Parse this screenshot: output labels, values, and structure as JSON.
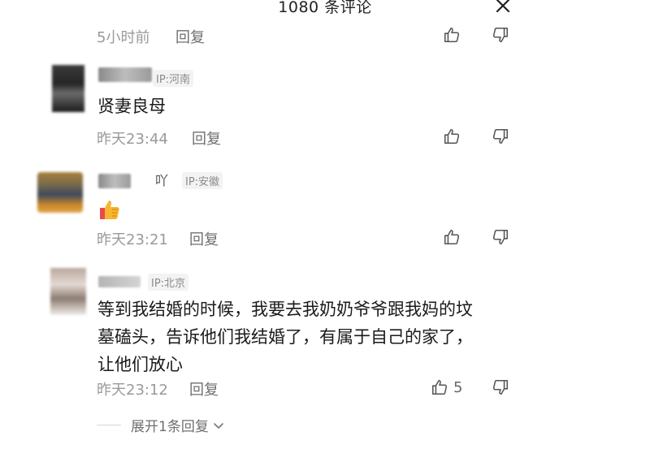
{
  "header": {
    "title": "1080 条评论",
    "close_icon": "close-icon"
  },
  "comments": [
    {
      "time": "5小时前",
      "reply_label": "回复"
    },
    {
      "ip": "IP:河南",
      "name_tail": "",
      "text": "贤妻良母",
      "time": "昨天23:44",
      "reply_label": "回复"
    },
    {
      "ip": "IP:安徽",
      "name_tail": "吖",
      "text": "",
      "emoji": "thumbs-up-emoji",
      "time": "昨天23:21",
      "reply_label": "回复"
    },
    {
      "ip": "IP:北京",
      "name_tail": "",
      "text_lines": [
        "等到我结婚的时候，我要去我奶奶爷爷跟我妈的坟",
        "墓磕头，告诉他们我结婚了，有属于自己的家了，",
        "让他们放心"
      ],
      "time": "昨天23:12",
      "reply_label": "回复",
      "like_count": "5"
    }
  ],
  "expand_replies": {
    "label": "展开1条回复"
  },
  "icons": {
    "like": "thumb-up-icon",
    "dislike": "thumb-down-icon"
  }
}
